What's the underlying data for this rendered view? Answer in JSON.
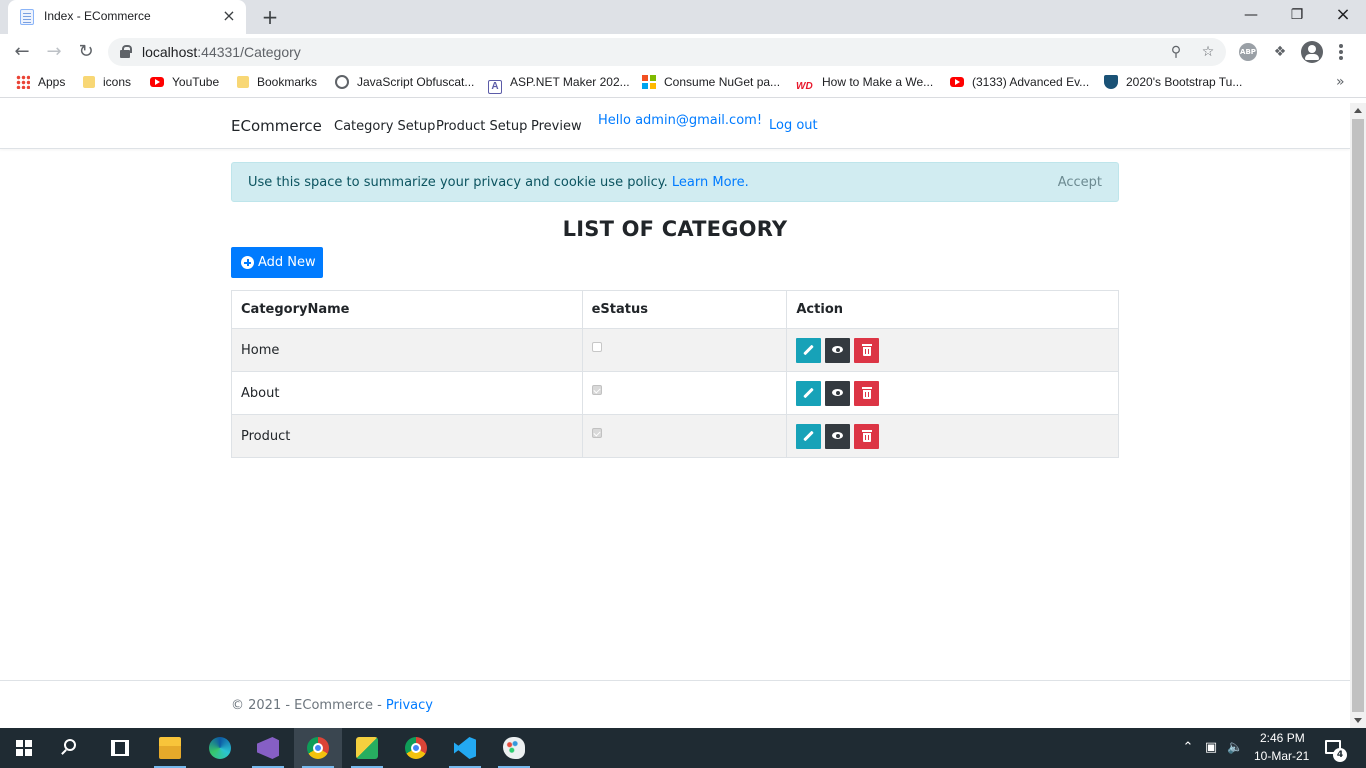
{
  "browser": {
    "tab_title": "Index - ECommerce",
    "new_tab_symbol": "+",
    "url_host": "localhost",
    "url_rest": ":44331/Category",
    "bookmarks": [
      {
        "label": "Apps",
        "icon": "apps-grid-icon"
      },
      {
        "label": "icons",
        "icon": "folder-icon"
      },
      {
        "label": "YouTube",
        "icon": "youtube-icon"
      },
      {
        "label": "Bookmarks",
        "icon": "folder-icon"
      },
      {
        "label": "JavaScript Obfuscat...",
        "icon": "globe-icon"
      },
      {
        "label": "ASP.NET Maker 202...",
        "icon": "aspnet-maker-icon"
      },
      {
        "label": "Consume NuGet pa...",
        "icon": "microsoft-icon"
      },
      {
        "label": "How to Make a We...",
        "icon": "webdesign-icon"
      },
      {
        "label": "(3133) Advanced Ev...",
        "icon": "youtube-icon"
      },
      {
        "label": "2020's Bootstrap Tu...",
        "icon": "shield-icon"
      }
    ],
    "bookmarks_overflow": "»"
  },
  "site": {
    "brand": "ECommerce",
    "nav": [
      "Category Setup",
      "Product Setup",
      "Preview"
    ],
    "hello": "Hello admin@gmail.com!",
    "logout": "Log out"
  },
  "cookie": {
    "text": "Use this space to summarize your privacy and cookie use policy.",
    "link": "Learn More.",
    "accept": "Accept"
  },
  "main": {
    "heading": "LIST OF CATEGORY",
    "add_button": "Add New",
    "table": {
      "headers": [
        "CategoryName",
        "eStatus",
        "Action"
      ],
      "rows": [
        {
          "name": "Home",
          "status": false
        },
        {
          "name": "About",
          "status": true
        },
        {
          "name": "Product",
          "status": true
        }
      ]
    }
  },
  "footer": {
    "text": "© 2021 - ECommerce - ",
    "link": "Privacy"
  },
  "taskbar": {
    "time": "2:46 PM",
    "date": "10-Mar-21",
    "notification_count": "4"
  },
  "colors": {
    "primary": "#007bff",
    "info": "#17a2b8",
    "dark": "#343a40",
    "danger": "#dc3545",
    "alert_bg": "#d1ecf1"
  }
}
